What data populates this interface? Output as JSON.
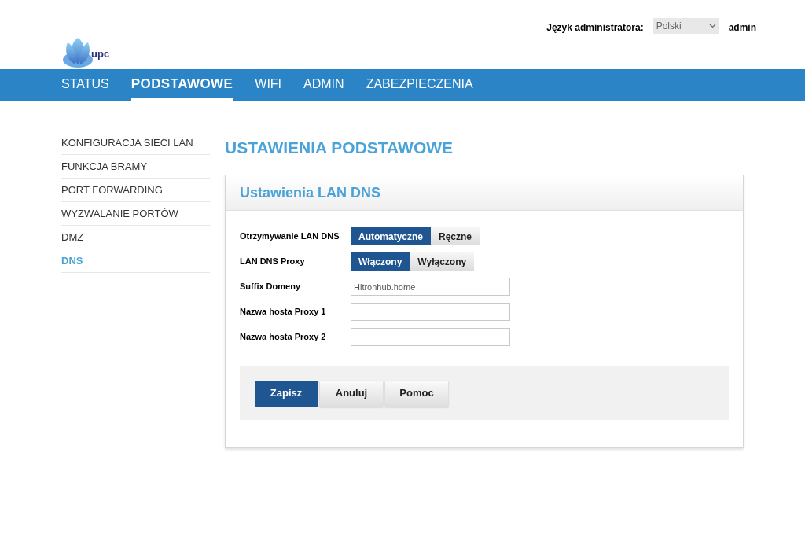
{
  "header": {
    "brand": "upc",
    "language_label": "Język administratora:",
    "language_select": {
      "value": "Polski"
    },
    "user": "admin"
  },
  "nav": [
    {
      "label": "STATUS",
      "selected": false
    },
    {
      "label": "PODSTAWOWE",
      "selected": true
    },
    {
      "label": "WIFI",
      "selected": false
    },
    {
      "label": "ADMIN",
      "selected": false
    },
    {
      "label": "ZABEZPIECZENIA",
      "selected": false
    }
  ],
  "sidebar": {
    "items": [
      {
        "label": "KONFIGURACJA SIECI LAN",
        "selected": false
      },
      {
        "label": "FUNKCJA BRAMY",
        "selected": false
      },
      {
        "label": "PORT FORWARDING",
        "selected": false
      },
      {
        "label": "WYZWALANIE PORTÓW",
        "selected": false
      },
      {
        "label": "DMZ",
        "selected": false
      },
      {
        "label": "DNS",
        "selected": true
      }
    ]
  },
  "page_title": "USTAWIENIA PODSTAWOWE",
  "panel": {
    "title": "Ustawienia LAN DNS",
    "rows": [
      {
        "kind": "toggle",
        "label": "Otrzymywanie LAN DNS",
        "options": [
          {
            "label": "Automatyczne",
            "selected": true
          },
          {
            "label": "Ręczne",
            "selected": false
          }
        ]
      },
      {
        "kind": "toggle",
        "label": "LAN DNS Proxy",
        "options": [
          {
            "label": "Włączony",
            "selected": true
          },
          {
            "label": "Wyłączony",
            "selected": false
          }
        ]
      },
      {
        "kind": "text",
        "label": "Suffix Domeny",
        "value": "Hitronhub.home"
      },
      {
        "kind": "text",
        "label": "Nazwa hosta Proxy 1",
        "value": ""
      },
      {
        "kind": "text",
        "label": "Nazwa hosta Proxy 2",
        "value": ""
      }
    ],
    "buttons": [
      {
        "label": "Zapisz",
        "kind": "primary"
      },
      {
        "label": "Anuluj",
        "kind": "secondary"
      },
      {
        "label": "Pomoc",
        "kind": "secondary"
      }
    ]
  }
}
